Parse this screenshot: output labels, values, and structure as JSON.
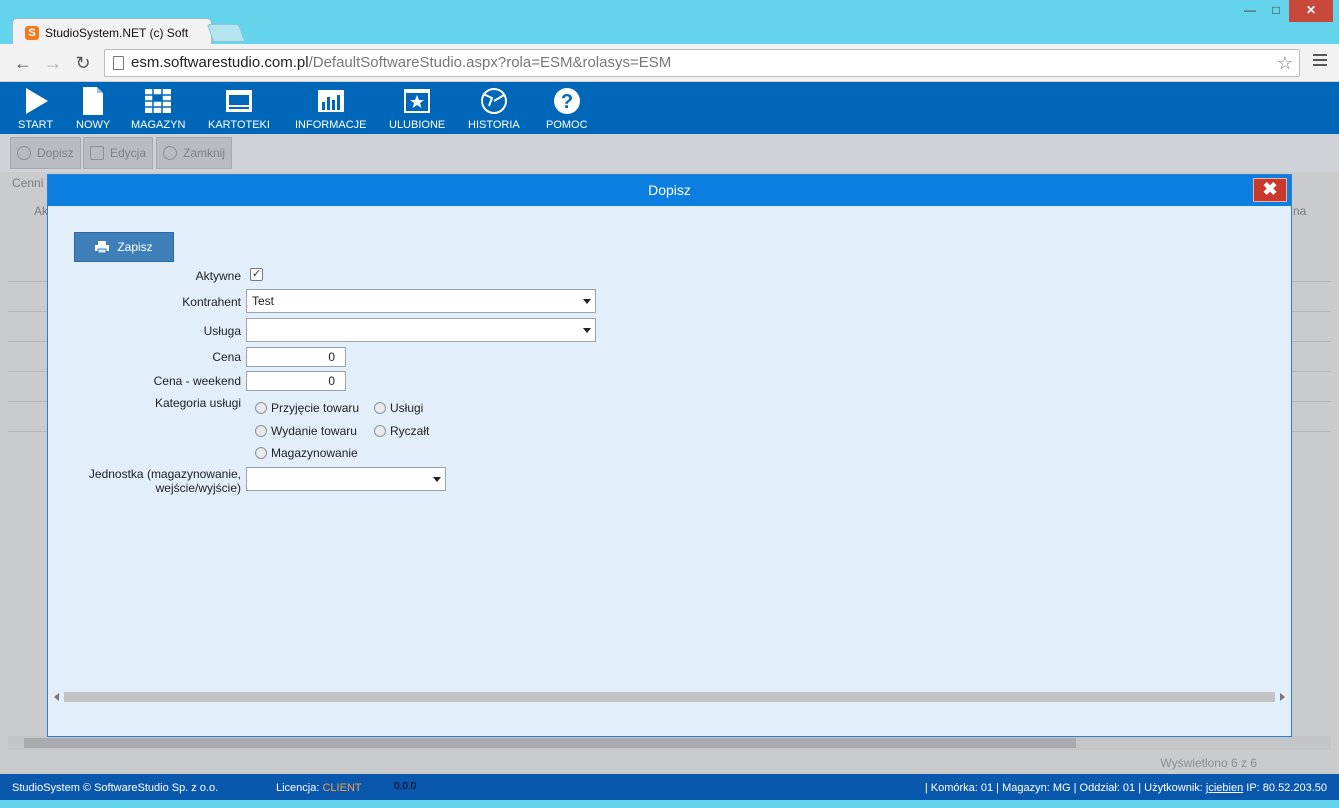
{
  "browser": {
    "tab_title": "StudioSystem.NET (c) Soft",
    "url_host": "esm.softwarestudio.com.pl",
    "url_path": "/DefaultSoftwareStudio.aspx?rola=ESM&rolasys=ESM"
  },
  "toolbar": {
    "items": [
      {
        "label": "START",
        "icon": "play-icon"
      },
      {
        "label": "NOWY",
        "icon": "new-document-icon"
      },
      {
        "label": "MAGAZYN",
        "icon": "warehouse-grid-icon"
      },
      {
        "label": "KARTOTEKI",
        "icon": "cards-icon"
      },
      {
        "label": "INFORMACJE",
        "icon": "bar-chart-icon"
      },
      {
        "label": "ULUBIONE",
        "icon": "star-icon"
      },
      {
        "label": "HISTORIA",
        "icon": "history-icon"
      },
      {
        "label": "POMOC",
        "icon": "help-icon"
      }
    ]
  },
  "actions": {
    "add": "Dopisz",
    "edit": "Edycja",
    "close": "Zamknij"
  },
  "background": {
    "section": "Cenni",
    "col_first": "Ak",
    "col_last": "na",
    "pager": "Wyświetlono 6 z 6"
  },
  "modal": {
    "title": "Dopisz",
    "save_label": "Zapisz",
    "fields": {
      "active_label": "Aktywne",
      "active_checked": true,
      "contractor_label": "Kontrahent",
      "contractor_value": "Test",
      "service_label": "Usługa",
      "service_value": "",
      "price_label": "Cena",
      "price_value": "0",
      "price_weekend_label": "Cena - weekend",
      "price_weekend_value": "0",
      "category_label": "Kategoria usługi",
      "category_options": [
        "Przyjęcie towaru",
        "Usługi",
        "Wydanie towaru",
        "Ryczałt",
        "Magazynowanie"
      ],
      "unit_label_line1": "Jednostka (magazynowanie,",
      "unit_label_line2": "wejście/wyjście)",
      "unit_value": ""
    }
  },
  "statusbar": {
    "copyright": "StudioSystem © SoftwareStudio Sp. z o.o.",
    "license_label": "Licencja:",
    "license_value": "CLIENT",
    "version": "0.0.0",
    "right_prefix": "| Komórka: 01 | Magazyn: MG | Oddział: 01 | Użytkownik:",
    "user": "jciebien",
    "ip": "IP: 80.52.203.50"
  },
  "colors": {
    "toolbar_bg": "#0067b8",
    "modal_header": "#0b7ee0",
    "close_red": "#c9392c",
    "license_orange": "#f0a04a"
  }
}
